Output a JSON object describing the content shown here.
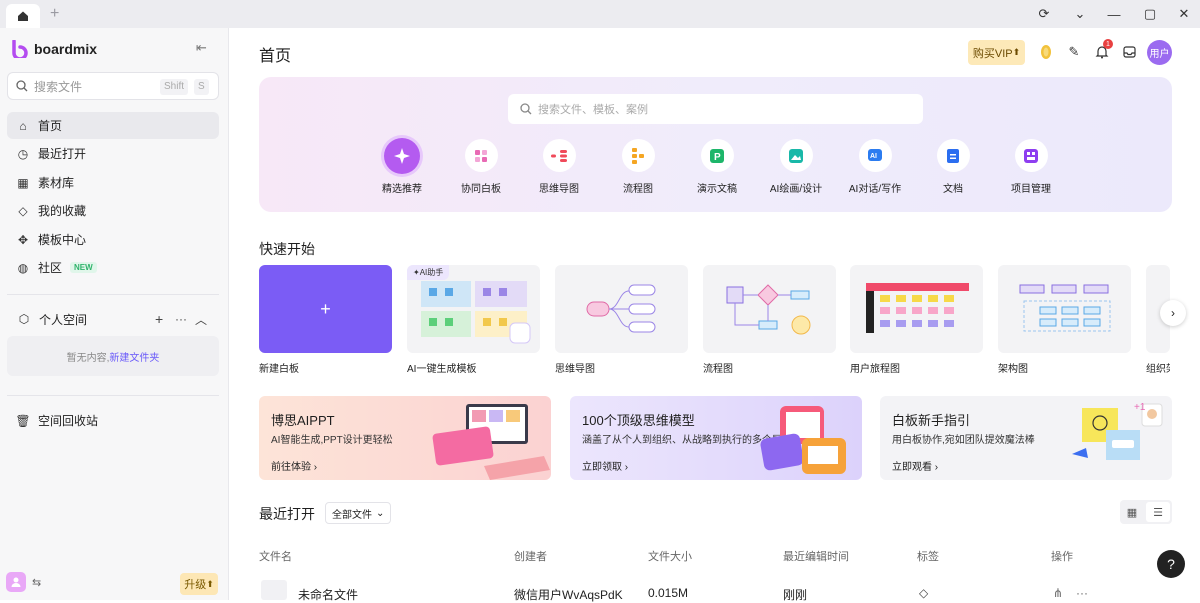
{
  "titlebar": {
    "add_tab": "+"
  },
  "sidebar": {
    "brand": "boardmix",
    "search": {
      "placeholder": "搜索文件",
      "shortcut1": "Shift",
      "shortcut2": "S"
    },
    "items": [
      {
        "label": "首页",
        "icon": "home-icon"
      },
      {
        "label": "最近打开",
        "icon": "clock-icon"
      },
      {
        "label": "素材库",
        "icon": "library-icon"
      },
      {
        "label": "我的收藏",
        "icon": "tag-icon"
      },
      {
        "label": "模板中心",
        "icon": "template-icon"
      },
      {
        "label": "社区",
        "icon": "planet-icon",
        "badge": "NEW"
      }
    ],
    "space": {
      "title": "个人空间",
      "empty_text": "暂无内容,",
      "empty_link": "新建文件夹"
    },
    "trash": "空间回收站",
    "upgrade": "升级"
  },
  "header": {
    "title": "首页",
    "vip": "购买VIP",
    "avatar": "用户",
    "notification_count": "1"
  },
  "hero": {
    "search_placeholder": "搜索文件、模板、案例",
    "categories": [
      {
        "label": "精选推荐",
        "icon": "sparkle-icon",
        "active": true
      },
      {
        "label": "协同白板",
        "icon": "whiteboard-icon"
      },
      {
        "label": "思维导图",
        "icon": "mindmap-icon"
      },
      {
        "label": "流程图",
        "icon": "flowchart-icon"
      },
      {
        "label": "演示文稿",
        "icon": "presentation-icon"
      },
      {
        "label": "AI绘画/设计",
        "icon": "ai-image-icon"
      },
      {
        "label": "AI对话/写作",
        "icon": "ai-chat-icon"
      },
      {
        "label": "文档",
        "icon": "document-icon"
      },
      {
        "label": "项目管理",
        "icon": "project-icon"
      }
    ]
  },
  "quick_start": {
    "title": "快速开始",
    "cards": [
      {
        "label": "新建白板"
      },
      {
        "label": "AI一键生成模板",
        "tag": "AI助手"
      },
      {
        "label": "思维导图"
      },
      {
        "label": "流程图"
      },
      {
        "label": "用户旅程图"
      },
      {
        "label": "架构图"
      },
      {
        "label": "组织架"
      }
    ]
  },
  "banners": [
    {
      "title": "博思AIPPT",
      "subtitle": "AI智能生成,PPT设计更轻松",
      "link": "前往体验"
    },
    {
      "title": "100个顶级思维模型",
      "subtitle": "涵盖了从个人到组织、从战略到执行的多个层面",
      "link": "立即领取"
    },
    {
      "title": "白板新手指引",
      "subtitle": "用白板协作,宛如团队提效魔法棒",
      "link": "立即观看"
    }
  ],
  "recent": {
    "title": "最近打开",
    "filter": "全部文件",
    "columns": [
      "文件名",
      "创建者",
      "文件大小",
      "最近编辑时间",
      "标签",
      "操作"
    ],
    "rows": [
      {
        "name": "未命名文件",
        "creator": "微信用户WvAqsPdK",
        "size": "0.015M",
        "edited": "刚刚"
      }
    ]
  },
  "help": "?"
}
